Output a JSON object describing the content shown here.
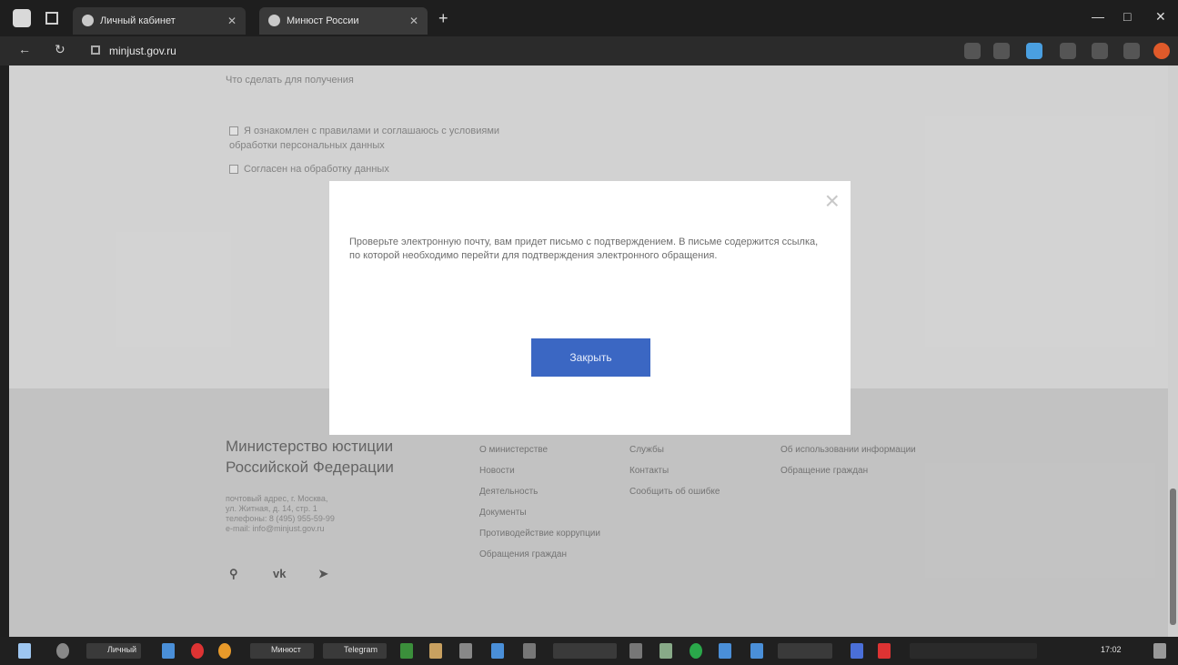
{
  "browser": {
    "tabs": [
      {
        "label": "Личный кабинет"
      },
      {
        "label": "Минюст России"
      }
    ],
    "new_tab": "+",
    "url": "minjust.gov.ru",
    "window_controls": [
      "—",
      "□",
      "✕"
    ]
  },
  "page": {
    "form": {
      "line1": "Что сделать для получения",
      "checkbox1_text": "Я ознакомлен с правилами и соглашаюсь с условиями",
      "checkbox1_sub": "обработки персональных данных",
      "checkbox2_text": "Согласен на обработку данных"
    },
    "modal": {
      "close_symbol": "×",
      "message": "Проверьте электронную почту, вам придет письмо с подтверждением. В письме содержится ссылка, по которой необходимо перейти для подтверждения электронного обращения.",
      "button_label": "Закрыть"
    },
    "footer": {
      "ministry_name": "Министерство юстиции Российской Федерации",
      "address": [
        "почтовый адрес, г. Москва,",
        "ул. Житная, д. 14, стр. 1",
        "телефоны: 8 (495) 955-59-99",
        "e-mail: info@minjust.gov.ru"
      ],
      "col1": [
        "О министерстве",
        "Новости",
        "Деятельность",
        "Документы",
        "Противодействие коррупции",
        "Обращения граждан"
      ],
      "col2": [
        "Службы",
        "Контакты",
        "Сообщить об ошибке"
      ],
      "col3": [
        "Об использовании информации",
        "Обращение граждан"
      ],
      "icons": [
        "search-icon",
        "vk-icon",
        "telegram-icon"
      ]
    }
  },
  "taskbar": {
    "clock": "17:02",
    "labels": [
      "Личный",
      "Минюст",
      "Telegram"
    ]
  }
}
